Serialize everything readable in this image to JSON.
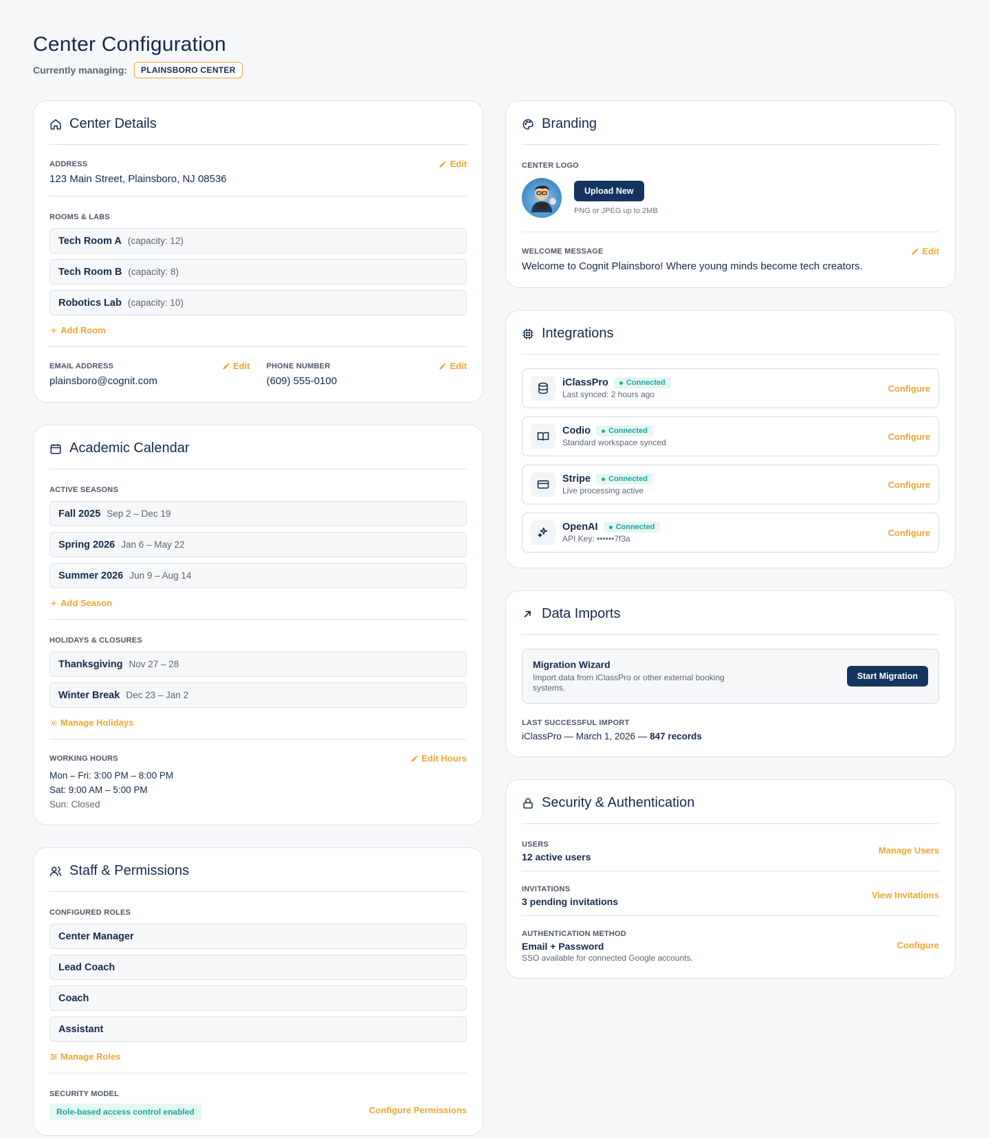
{
  "header": {
    "title": "Center Configuration",
    "managing_label": "Currently managing:",
    "center_name": "PLAINSBORO CENTER"
  },
  "center_details": {
    "title": "Center Details",
    "address_label": "ADDRESS",
    "address": "123 Main Street, Plainsboro, NJ 08536",
    "edit_label": "Edit",
    "rooms_label": "ROOMS & LABS",
    "rooms": [
      {
        "name": "Tech Room A",
        "meta": "(capacity: 12)"
      },
      {
        "name": "Tech Room B",
        "meta": "(capacity: 8)"
      },
      {
        "name": "Robotics Lab",
        "meta": "(capacity: 10)"
      }
    ],
    "add_room": "Add Room",
    "email_label": "EMAIL ADDRESS",
    "email": "plainsboro@cognit.com",
    "phone_label": "PHONE NUMBER",
    "phone": "(609) 555-0100"
  },
  "calendar": {
    "title": "Academic Calendar",
    "seasons_label": "ACTIVE SEASONS",
    "seasons": [
      {
        "name": "Fall 2025",
        "meta": "Sep 2 – Dec 19"
      },
      {
        "name": "Spring 2026",
        "meta": "Jan 6 – May 22"
      },
      {
        "name": "Summer 2026",
        "meta": "Jun 9 – Aug 14"
      }
    ],
    "add_season": "Add Season",
    "holidays_label": "HOLIDAYS & CLOSURES",
    "holidays": [
      {
        "name": "Thanksgiving",
        "meta": "Nov 27 – 28"
      },
      {
        "name": "Winter Break",
        "meta": "Dec 23 – Jan 2"
      }
    ],
    "manage_holidays": "Manage Holidays",
    "hours_label": "WORKING HOURS",
    "edit_hours": "Edit Hours",
    "hours": [
      "Mon – Fri: 3:00 PM – 8:00 PM",
      "Sat: 9:00 AM – 5:00 PM",
      "Sun: Closed"
    ]
  },
  "staff": {
    "title": "Staff & Permissions",
    "roles_label": "CONFIGURED ROLES",
    "roles": [
      "Center Manager",
      "Lead Coach",
      "Coach",
      "Assistant"
    ],
    "manage_roles": "Manage Roles",
    "security_label": "SECURITY MODEL",
    "security_badge": "Role-based access control enabled",
    "configure_permissions": "Configure Permissions"
  },
  "branding": {
    "title": "Branding",
    "logo_label": "CENTER LOGO",
    "upload_button": "Upload New",
    "upload_hint": "PNG or JPEG up to 2MB",
    "welcome_label": "WELCOME MESSAGE",
    "welcome": "Welcome to Cognit Plainsboro! Where young minds become tech creators.",
    "edit_label": "Edit"
  },
  "integrations": {
    "title": "Integrations",
    "connected_label": "Connected",
    "configure_label": "Configure",
    "items": [
      {
        "name": "iClassPro",
        "sub": "Last synced: 2 hours ago",
        "icon": "database-icon"
      },
      {
        "name": "Codio",
        "sub": "Standard workspace synced",
        "icon": "book-icon"
      },
      {
        "name": "Stripe",
        "sub": "Live processing active",
        "icon": "credit-card-icon"
      },
      {
        "name": "OpenAI",
        "sub": "API Key: ••••••7f3a",
        "icon": "sparkles-icon"
      }
    ]
  },
  "imports": {
    "title": "Data Imports",
    "wizard_title": "Migration Wizard",
    "wizard_desc": "Import data from iClassPro or other external booking systems.",
    "start_button": "Start Migration",
    "last_label": "LAST SUCCESSFUL IMPORT",
    "last_value": "iClassPro — March 1, 2026 — ",
    "last_records": "847 records"
  },
  "security": {
    "title": "Security & Authentication",
    "users_label": "USERS",
    "users_value": "12 active users",
    "manage_users": "Manage Users",
    "invitations_label": "INVITATIONS",
    "invitations_value": "3 pending invitations",
    "view_invitations": "View Invitations",
    "auth_label": "AUTHENTICATION METHOD",
    "auth_value": "Email + Password",
    "auth_sub": "SSO available for connected Google accounts.",
    "configure": "Configure"
  },
  "colors": {
    "primary": "#13294b",
    "accent": "#f0a630",
    "success": "#1ba89a",
    "button_dark": "#13355f"
  }
}
